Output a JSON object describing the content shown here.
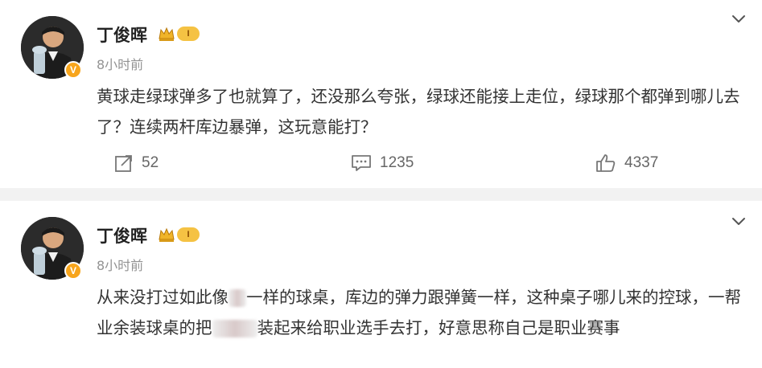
{
  "posts": [
    {
      "username": "丁俊晖",
      "level": "I",
      "verified_mark": "V",
      "timestamp": "8小时前",
      "text": "黄球走绿球弹多了也就算了，还没那么夸张，绿球还能接上走位，绿球那个都弹到哪儿去了？连续两杆库边暴弹，这玩意能打？",
      "repost_count": "52",
      "comment_count": "1235",
      "like_count": "4337"
    },
    {
      "username": "丁俊晖",
      "level": "I",
      "verified_mark": "V",
      "timestamp": "8小时前",
      "text_part1": "从来没打过如此像",
      "text_part2": "一样的球桌，库边的弹力跟弹簧一样，这种桌子哪儿来的控球，一帮业余装球桌的把",
      "text_part3": "装起来给职业选手去打，好意思称自己是职业赛事"
    }
  ],
  "icons": {
    "repost": "repost-icon",
    "comment": "comment-icon",
    "like": "like-icon",
    "menu": "chevron-down-icon",
    "crown": "crown-icon"
  },
  "colors": {
    "background": "#f2f2f2",
    "card": "#ffffff",
    "text": "#333333",
    "muted": "#939393",
    "badge_orange": "#f7a51c",
    "level_gold": "#f5c243"
  }
}
